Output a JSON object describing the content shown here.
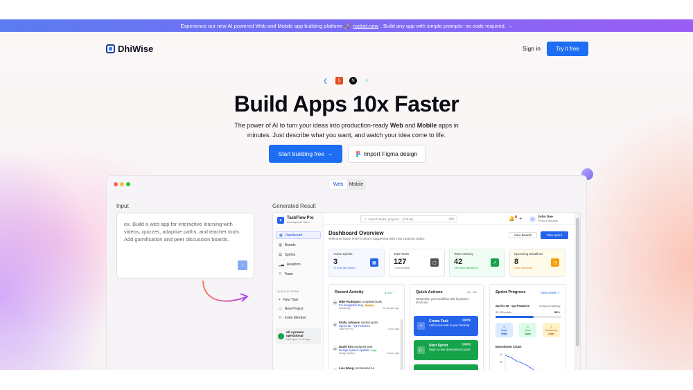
{
  "banner": {
    "text_before": "Experience our new AI powered Web and Mobile app building platform",
    "link": "rocket.new",
    "text_after": ". Build any app with simple prompts- no code required. →"
  },
  "nav": {
    "brand": "DhiWise",
    "signin": "Sign in",
    "try": "Try it free"
  },
  "hero": {
    "title": "Build Apps 10x Faster",
    "sub_a": "The power of AI to turn your ideas into production-ready ",
    "sub_web": "Web",
    "sub_and": " and ",
    "sub_mobile": "Mobile",
    "sub_b": " apps in minutes. Just describe what you want, and watch your idea come to life.",
    "start": "Start building free",
    "figma": "Import Figma design"
  },
  "tabs": {
    "web": "Web",
    "mobile": "Mobile"
  },
  "demo": {
    "input_label": "Input",
    "result_label": "Generated Result",
    "input_placeholder": "ex. Build a web app for interactive learning with videos, quizzes, adaptive paths, and teacher tools. Add gamification and peer discussion boards."
  },
  "app": {
    "brand": "TaskFlow Pro",
    "brand_sub": "Development Team",
    "nav": [
      "Dashboard",
      "Boards",
      "Sprints",
      "Analytics",
      "Team"
    ],
    "quick_title": "QUICK ACTIONS",
    "quick": [
      "New Task",
      "New Project",
      "Invite Member"
    ],
    "sys_title": "All systems operational",
    "sys_sub": "Last sync: 2 min ago",
    "search": "Search tasks, projects... (Ctrl+K)",
    "search_kbd": "⌘ K",
    "bell_count": "3",
    "user_initials": "JD",
    "user_name": "John Doe",
    "user_role": "Product Manager",
    "title": "Dashboard Overview",
    "subtitle": "Welcome back! Here's what's happening with your projects today.",
    "view_boards": "View Boards",
    "plan_sprint": "Plan Sprint",
    "cards": [
      {
        "title": "Active Sprints",
        "value": "3",
        "sub": "+2 from last month",
        "color": "#2563eb"
      },
      {
        "title": "Total Tasks",
        "value": "127",
        "sub": "+15 this week",
        "color": "#555"
      },
      {
        "title": "Team Velocity",
        "value": "42",
        "sub": "+8% from last sprint",
        "color": "#16a34a"
      },
      {
        "title": "Upcoming Deadlines",
        "value": "8",
        "sub": "3 due this week",
        "color": "#f59e0b"
      }
    ],
    "recent_title": "Recent Activity",
    "live": "Live",
    "activity": [
      {
        "name": "Mike Rodriguez",
        "action": "completed task",
        "item": "Fix navigation bug",
        "tag": "Medium",
        "proj": "Mobile App",
        "time": "15 minutes ago",
        "av": "MR"
      },
      {
        "name": "Emily Johnson",
        "action": "started sprint",
        "item": "Sprint 15 - Q1 Features",
        "tag": "",
        "proj": "TaskFlow Pro",
        "time": "1 hour ago",
        "av": "EJ"
      },
      {
        "name": "David Kim",
        "action": "assigned task",
        "item": "Design system updates",
        "tag": "Low",
        "proj": "Design System",
        "time": "2 hours ago",
        "av": "DK"
      },
      {
        "name": "Lisa Wang",
        "action": "commented on",
        "item": "",
        "tag": "",
        "proj": "",
        "time": "",
        "av": "LW"
      }
    ],
    "qa_title": "Quick Actions",
    "qa_kbd": "Ctrl + Alt",
    "qa_sub": "Streamline your workflow with keyboard shortcuts",
    "qa_items": [
      {
        "title": "Create Task",
        "sub": "Add a new task to your backlog",
        "kbd": "Ctrl+N",
        "color": "#2563eb"
      },
      {
        "title": "Start Sprint",
        "sub": "Begin a new development sprint",
        "kbd": "Ctrl+S",
        "color": "#16a34a"
      }
    ],
    "sp_title": "Sprint Progress",
    "sp_view": "View Details",
    "sp_name": "Sprint 15 - Q1 Features",
    "sp_days": "6 days remaining",
    "sp_points": "32 / 55 points",
    "sp_pct": "58%",
    "sp_progress": 0.58,
    "sp_cards": [
      {
        "label": "Target",
        "val": "55pts",
        "color": "#dbeafe",
        "tc": "#1d4ed8"
      },
      {
        "label": "Done",
        "val": "32pts",
        "color": "#dcfce7",
        "tc": "#15803d"
      },
      {
        "label": "Remaining",
        "val": "23pts",
        "color": "#fef3c7",
        "tc": "#b45309"
      }
    ],
    "burn_title": "Burndown Chart",
    "burn_y1": "60",
    "burn_y2": "45"
  },
  "colors": {
    "accent": "#1d6ef2"
  }
}
